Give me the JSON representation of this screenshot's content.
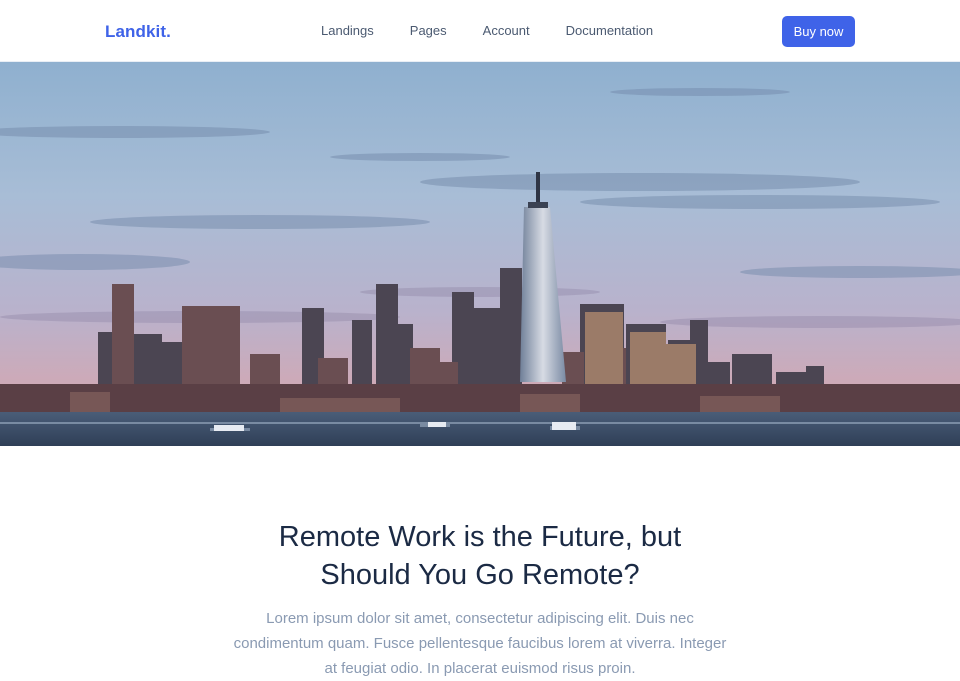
{
  "navbar": {
    "brand": "Landkit.",
    "links": [
      "Landings",
      "Pages",
      "Account",
      "Documentation"
    ],
    "cta_label": "Buy now"
  },
  "hero": {
    "image_subject": "city-skyline-photo"
  },
  "article": {
    "title_line1": "Remote Work is the Future, but",
    "title_line2": "Should You Go Remote?",
    "lead": "Lorem ipsum dolor sit amet, consectetur adipiscing elit. Duis nec condimentum quam. Fusce pellentesque faucibus lorem at viverra. Integer at feugiat odio. In placerat euismod risus proin."
  },
  "colors": {
    "accent": "#3f63e8",
    "heading": "#1b2a44",
    "muted": "#8a9ab2"
  }
}
